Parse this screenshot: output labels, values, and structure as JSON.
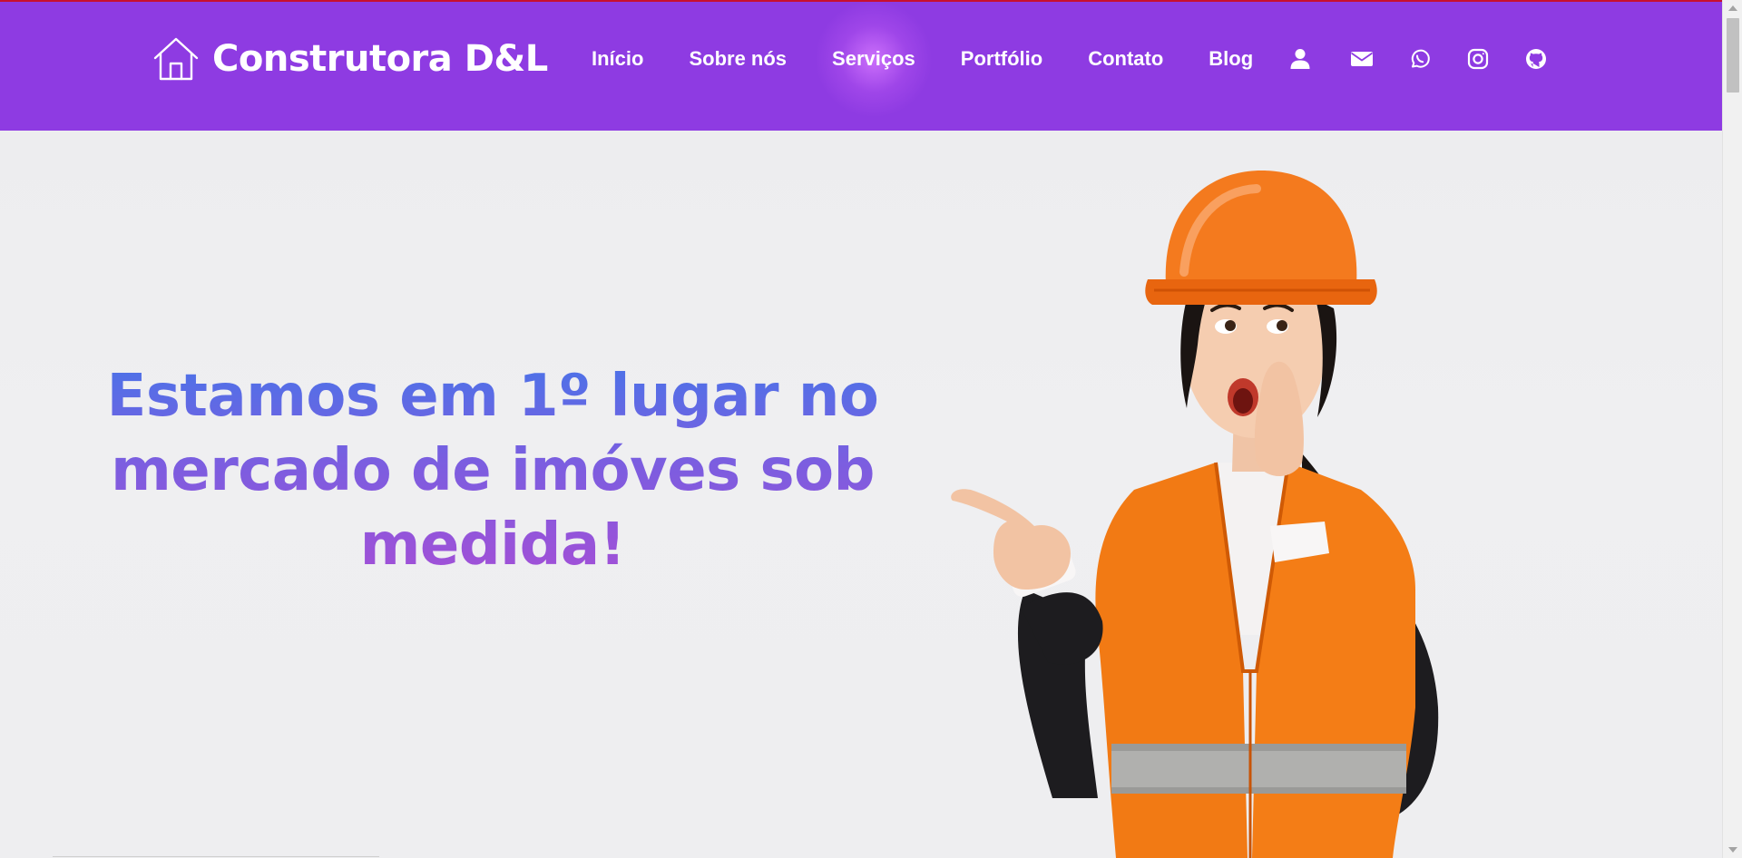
{
  "brand": {
    "icon": "house-outline-icon",
    "name": "Construtora D&L"
  },
  "nav": {
    "items": [
      {
        "label": "Início",
        "active": false
      },
      {
        "label": "Sobre nós",
        "active": false
      },
      {
        "label": "Serviços",
        "active": true
      },
      {
        "label": "Portfólio",
        "active": false
      },
      {
        "label": "Contato",
        "active": false
      },
      {
        "label": "Blog",
        "active": false
      }
    ],
    "icons": [
      "user-icon",
      "mail-icon",
      "whatsapp-icon",
      "instagram-icon",
      "github-icon"
    ]
  },
  "hero": {
    "headline": "Estamos em 1º lugar no mercado de imóves sob medida!",
    "image": "construction-worker-woman-pointing"
  },
  "colors": {
    "navbar": "#8e3be2",
    "top_line": "#c8102e",
    "headline_gradient": [
      "#4a73e8",
      "#7a5ee0",
      "#a44fd6"
    ],
    "hero_background": "#eeeef0"
  }
}
